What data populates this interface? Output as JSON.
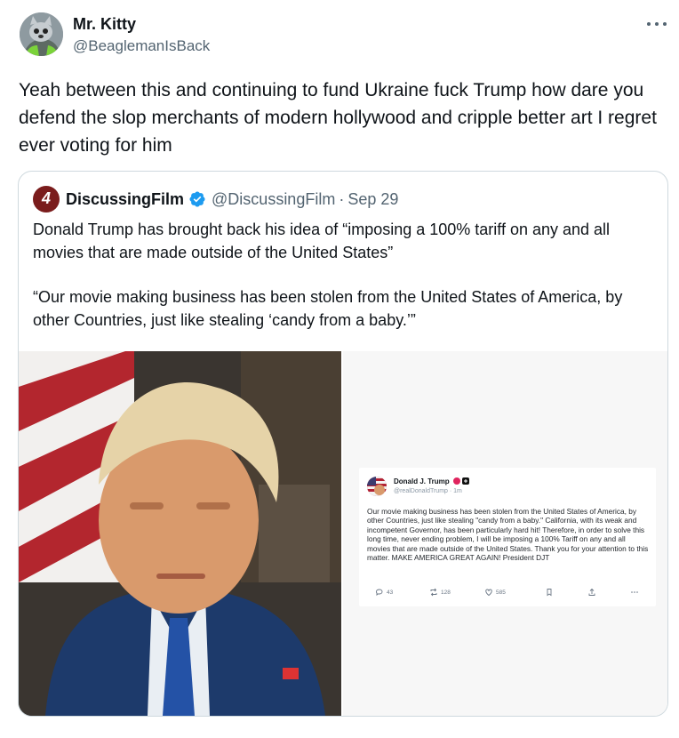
{
  "tweet": {
    "author_name": "Mr. Kitty",
    "author_handle": "@BeaglemanIsBack",
    "text": "Yeah between this and continuing to fund Ukraine fuck Trump how dare you defend the slop merchants of modern hollywood and cripple better art I regret ever voting for him"
  },
  "quote": {
    "logo_text": "4",
    "author_name": "DiscussingFilm",
    "author_handle": "@DiscussingFilm",
    "separator": "·",
    "date": "Sep 29",
    "paragraph1": "Donald Trump has brought back his idea of “imposing a 100% tariff on any and all movies that are made outside of the United States”",
    "paragraph2": "“Our movie making business has been stolen from the United States of America, by other Countries, just like stealing ‘candy from a baby.’”"
  },
  "screenshot_post": {
    "author_name": "Donald J. Trump",
    "author_handle": "@realDonaldTrump · 1m",
    "text": "Our movie making business has been stolen from the United States of America, by other Countries, just like stealing \"candy from a baby.\" California, with its weak and incompetent Governor, has been particularly hard hit! Therefore, in order to solve this long time, never ending problem, I will be imposing a 100% Tariff on any and all movies that are made outside of the United States. Thank you for your attention to this matter. MAKE AMERICA GREAT AGAIN! President DJT",
    "replies": "43",
    "reposts": "128",
    "likes": "585"
  },
  "colors": {
    "accent": "#1d9bf0",
    "muted_text": "#536471",
    "border": "#cfd9de",
    "logo_bg": "#7a1c1c"
  },
  "icons": [
    "more-icon",
    "verified-icon",
    "reply-icon",
    "repost-icon",
    "like-icon",
    "bookmark-icon",
    "share-icon"
  ]
}
